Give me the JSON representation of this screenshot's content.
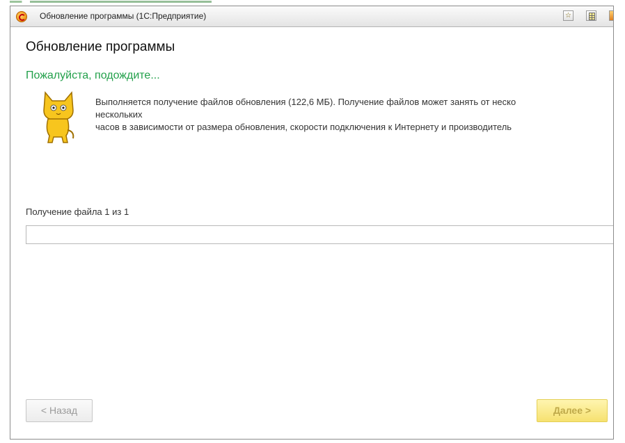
{
  "window": {
    "title": "Обновление программы  (1С:Предприятие)"
  },
  "content": {
    "heading": "Обновление программы",
    "wait": "Пожалуйста, подождите...",
    "message_lines": [
      "Выполняется получение файлов обновления (122,6 МБ). Получение файлов может занять от неско",
      "нескольких",
      "часов в зависимости от размера обновления, скорости подключения к Интернету и производитель"
    ],
    "progress_label": "Получение файла 1 из 1",
    "progress_value": 0
  },
  "buttons": {
    "back": "< Назад",
    "next": "Далее >"
  },
  "icons": {
    "app": "1c-logo-icon",
    "favorite": "star-icon",
    "table": "table-icon",
    "calculator": "calculator-icon",
    "mascot": "cat-mascot-icon"
  },
  "colors": {
    "accent_green": "#22a04a",
    "next_button_yellow": "#f6e170"
  }
}
